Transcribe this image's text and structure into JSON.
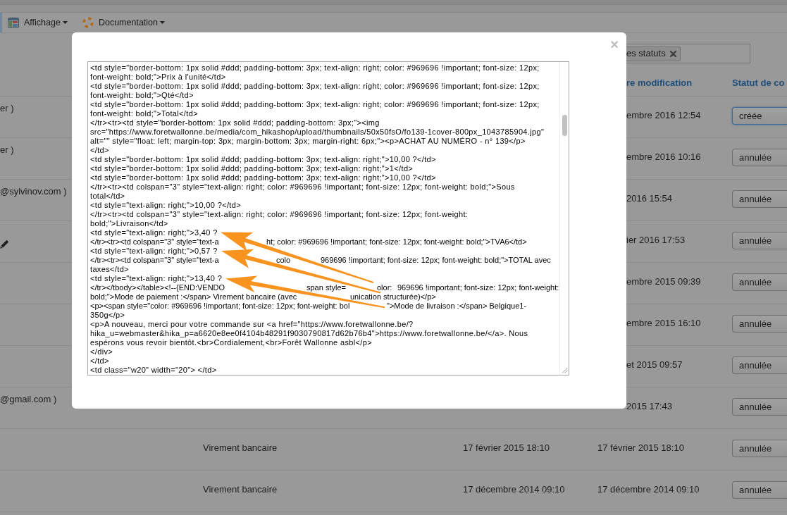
{
  "toolbar": {
    "menus": [
      {
        "label": "Affichage"
      },
      {
        "label": "Documentation"
      }
    ]
  },
  "filter": {
    "tags": [
      {
        "label": "es statuts"
      }
    ]
  },
  "table": {
    "headers": {
      "column_4": "re modification",
      "column_5": "Statut de co"
    },
    "rows": [
      {
        "column_1": "er )",
        "edit_icon": false,
        "column_4": "embre 2016 12:54",
        "column_5": {
          "value": "créée",
          "focused": true
        }
      },
      {
        "column_1": "er )",
        "edit_icon": false,
        "column_4": "embre 2016 10:16",
        "column_5": {
          "value": "annulée",
          "focused": false
        }
      },
      {
        "column_1": "@sylvinov.com )",
        "edit_icon": false,
        "column_4": "2016 15:54",
        "column_5": {
          "value": "annulée",
          "focused": false
        }
      },
      {
        "edit_icon": true,
        "column_4": "ier 2016 17:53",
        "column_5": {
          "value": "annulée",
          "focused": false
        }
      },
      {
        "edit_icon": false,
        "column_4": "embre 2015 09:39",
        "column_5": {
          "value": "annulée",
          "focused": false
        }
      },
      {
        "edit_icon": false,
        "column_4": "embre 2015 16:10",
        "column_5": {
          "value": "annulée",
          "focused": false
        }
      },
      {
        "edit_icon": false,
        "column_4": "et 2015 09:57",
        "column_5": {
          "value": "annulée",
          "focused": false
        }
      },
      {
        "column_1": "@gmail.com )",
        "edit_icon": false,
        "column_4": "2015 17:43",
        "column_5": {
          "value": "annulée",
          "focused": false
        }
      },
      {
        "edit_icon": false,
        "column_2": "Virement bancaire",
        "column_3": "17 février 2015 18:10",
        "column_4": "17 février 2015 18:10",
        "column_5": {
          "value": "annulée",
          "focused": false
        }
      },
      {
        "edit_icon": false,
        "column_2": "Virement bancaire",
        "column_3": "17 décembre 2014 09:10",
        "column_4": "17 décembre 2014 09:10",
        "column_5": {
          "value": "annulée",
          "focused": false
        }
      }
    ]
  },
  "modal": {
    "close": "×",
    "source_lines": [
      "<td style=\"border-bottom: 1px solid #ddd; padding-bottom: 3px; text-align: right; color: #969696 !important; font-size: 12px;",
      "font-weight: bold;\">Prix à l'unité</td>",
      "<td style=\"border-bottom: 1px solid #ddd; padding-bottom: 3px; text-align: right; color: #969696 !important; font-size: 12px;",
      "font-weight: bold;\">Qté</td>",
      "<td style=\"border-bottom: 1px solid #ddd; padding-bottom: 3px; text-align: right; color: #969696 !important; font-size: 12px;",
      "font-weight: bold;\">Total</td>",
      "</tr><tr><td style=\"border-bottom: 1px solid #ddd; padding-bottom: 3px;\"><img",
      "src=\"https://www.foretwallonne.be/media/com_hikashop/upload/thumbnails/50x50fsO/fo139-1cover-800px_1043785904.jpg\"",
      "alt=\"\" style=\"float: left; margin-top: 3px; margin-bottom: 3px; margin-right: 6px;\"><p>ACHAT AU NUMÉRO - n° 139</p>",
      "</td>",
      "<td style=\"border-bottom: 1px solid #ddd; padding-bottom: 3px; text-align: right;\">10,00 ?</td>",
      "<td style=\"border-bottom: 1px solid #ddd; padding-bottom: 3px; text-align: right;\">1</td>",
      "<td style=\"border-bottom: 1px solid #ddd; padding-bottom: 3px; text-align: right;\">10,00 ?</td>",
      "</tr><tr><td colspan=\"3\" style=\"text-align: right; color: #969696 !important; font-size: 12px; font-weight: bold;\">Sous",
      "total</td>",
      "<td style=\"text-align: right;\">10,00 ?</td>",
      "</tr><tr><td colspan=\"3\" style=\"text-align: right; color: #969696 !important; font-size: 12px; font-weight:",
      "bold;\">Livraison</td>",
      "<td style=\"text-align: right;\">3,40 ?",
      [
        "</tr><tr><td colspan=\"3\" style=\"text-a",
        "ht; color: #969696 !important; font-size: 12px; font-weight: bold;\">TVA6</td>"
      ],
      "<td style=\"text-align: right;\">0,57 ?",
      [
        "</tr><tr><td colspan=\"3\" style=\"text-a",
        "colo",
        "969696 !important; font-size: 12px; font-weight: bold;\">TOTAL avec"
      ],
      "taxes</td>",
      "<td style=\"text-align: right;\">13,40 ?",
      [
        "</tr></tbody></table><!--{END:VENDO",
        "span style=",
        "olor:",
        "969696 !important; font-size: 12px; font-weight:"
      ],
      [
        "bold;\">Mode de paiement :</span> Virement bancaire (avec",
        "unication structurée)</p>"
      ],
      [
        "<p><span style=\"color: #969696 !important; font-size: 12px; font-weight: bol",
        "\">Mode de livraison :</span> Belgique1-"
      ],
      "350g</p>",
      "<p>A nouveau, merci pour votre commande sur <a href=\"https://www.foretwallonne.be/?",
      "hika_u=webmaster&hika_p=a6620e8ee0f4104b48291f9030790817d62b76b4\">https://www.foretwallonne.be/</a>. Nous",
      "espérons vous revoir bientôt.<br>Cordialement,<br>Forêt Wallonne asbl</p>",
      "</div>",
      "</td>",
      "<td class=\"w20\" width=\"20\"> </td>"
    ],
    "annotations": [
      {
        "kind": "arrow"
      },
      {
        "kind": "arrow"
      },
      {
        "kind": "arrow"
      }
    ]
  }
}
